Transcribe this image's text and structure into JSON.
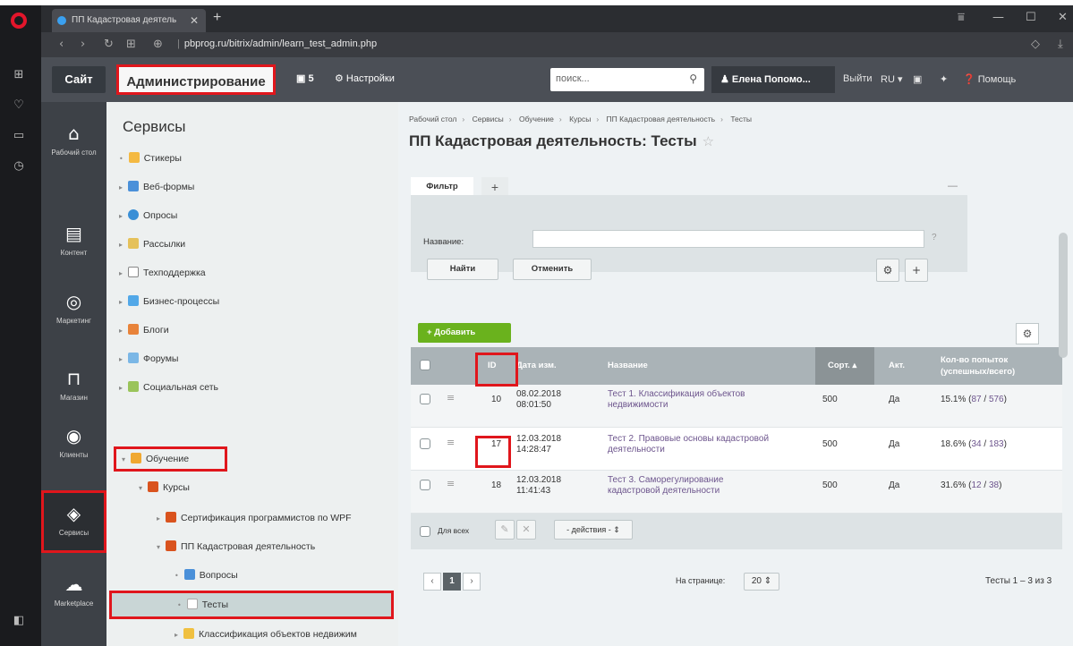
{
  "browser": {
    "tab_title": "ПП Кадастровая деятель",
    "tab_close": "✕",
    "new_tab": "+",
    "url": "pbprog.ru/bitrix/admin/learn_test_admin.php",
    "window_controls": [
      "⩸",
      "—",
      "☐",
      "✕"
    ]
  },
  "topbar": {
    "site": "Сайт",
    "admin": "Администрирование",
    "notifications": "5",
    "settings": "Настройки",
    "search_placeholder": "поиск...",
    "user": "Елена Попомо...",
    "logout": "Выйти",
    "lang": "RU",
    "help": "Помощь"
  },
  "left_menu": [
    {
      "label": "Рабочий стол",
      "icon": "home-icon"
    },
    {
      "label": "Контент",
      "icon": "document-icon"
    },
    {
      "label": "Маркетинг",
      "icon": "target-icon"
    },
    {
      "label": "Магазин",
      "icon": "cart-icon"
    },
    {
      "label": "Клиенты",
      "icon": "clients-icon"
    },
    {
      "label": "Сервисы",
      "icon": "layers-icon"
    },
    {
      "label": "Marketplace",
      "icon": "cloud-icon"
    }
  ],
  "tree": {
    "title": "Сервисы",
    "items": [
      {
        "label": "Стикеры"
      },
      {
        "label": "Веб-формы"
      },
      {
        "label": "Опросы"
      },
      {
        "label": "Рассылки"
      },
      {
        "label": "Техподдержка"
      },
      {
        "label": "Бизнес-процессы"
      },
      {
        "label": "Блоги"
      },
      {
        "label": "Форумы"
      },
      {
        "label": "Социальная сеть"
      },
      {
        "label": "Обучение"
      },
      {
        "label": "Курсы"
      },
      {
        "label": "Сертификация программистов по WPF"
      },
      {
        "label": "ПП Кадастровая деятельность"
      },
      {
        "label": "Вопросы"
      },
      {
        "label": "Тесты"
      },
      {
        "label": "Классификация объектов недвижим"
      }
    ]
  },
  "breadcrumb": [
    "Рабочий стол",
    "Сервисы",
    "Обучение",
    "Курсы",
    "ПП Кадастровая деятельность",
    "Тесты"
  ],
  "page_title": "ПП Кадастровая деятельность: Тесты",
  "filter": {
    "tab": "Фильтр",
    "label": "Название:",
    "value": "",
    "find": "Найти",
    "cancel": "Отменить"
  },
  "add_button": "Добавить",
  "grid": {
    "columns": [
      "ID",
      "Дата изм.",
      "Название",
      "Сорт.",
      "Акт.",
      "Кол-во попыток",
      "(успешных/всего)"
    ],
    "rows": [
      {
        "id": "10",
        "date1": "08.02.2018",
        "date2": "08:01:50",
        "name1": "Тест 1. Классификация объектов",
        "name2": "недвижимости",
        "sort": "500",
        "active": "Да",
        "pct": "15.1%",
        "ok": "87",
        "total": "576"
      },
      {
        "id": "17",
        "date1": "12.03.2018",
        "date2": "14:28:47",
        "name1": "Тест 2. Правовые основы кадастровой",
        "name2": "деятельности",
        "sort": "500",
        "active": "Да",
        "pct": "18.6%",
        "ok": "34",
        "total": "183"
      },
      {
        "id": "18",
        "date1": "12.03.2018",
        "date2": "11:41:43",
        "name1": "Тест 3. Саморегулирование",
        "name2": "кадастровой деятельности",
        "sort": "500",
        "active": "Да",
        "pct": "31.6%",
        "ok": "12",
        "total": "38"
      }
    ],
    "for_all": "Для всех",
    "actions": "- действия -"
  },
  "pager": {
    "current": "1",
    "per_page_label": "На странице:",
    "per_page": "20",
    "summary": "Тесты 1 – 3 из 3"
  }
}
